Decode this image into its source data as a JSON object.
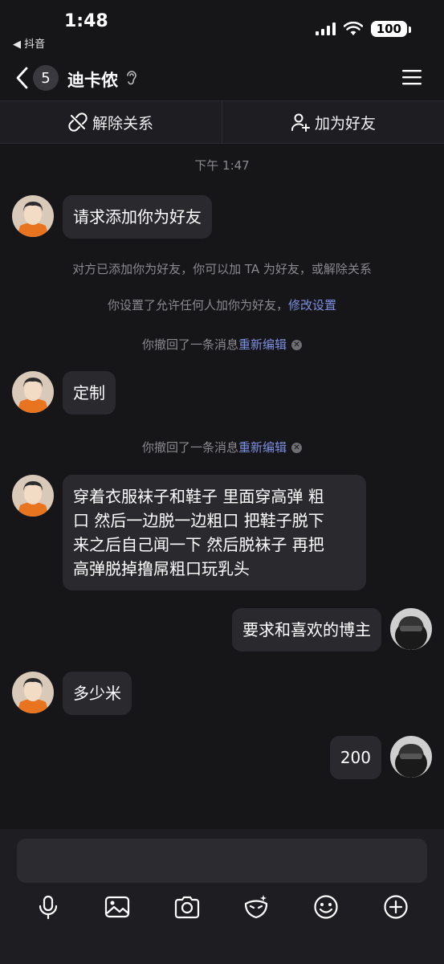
{
  "status_bar": {
    "time": "1:48",
    "back_app": "◀ 抖音",
    "battery": "100"
  },
  "header": {
    "unread_count": "5",
    "contact_name": "迪卡侬"
  },
  "actions": {
    "remove_relation": "解除关系",
    "add_friend": "加为好友"
  },
  "chat": {
    "timestamp": "下午 1:47",
    "msg1": "请求添加你为好友",
    "sys_added": "对方已添加你为好友，你可以加 TA 为好友，或解除关系",
    "sys_settings": "你设置了允许任何人加你为好友，",
    "sys_settings_link": "修改设置",
    "recall1_text": "你撤回了一条消息",
    "recall1_link": "重新编辑",
    "msg2": "定制",
    "recall2_text": "你撤回了一条消息",
    "recall2_link": "重新编辑",
    "msg3_line1": "穿着衣服袜子和鞋子 里面穿高弹 粗",
    "msg3_line2": "口 然后一边脱一边粗口 把鞋子脱下",
    "msg3_line3": "来之后自己闻一下 然后脱袜子 再把",
    "msg3_line4": "高弹脱掉撸屌粗口玩乳头",
    "msg4_self": "要求和喜欢的博主",
    "msg5": "多少米",
    "msg6_self": "200"
  },
  "colors": {
    "background": "#161619",
    "bubble": "#2a2a2e",
    "link": "#7d8fe0",
    "avatar_orange": "#e8741f"
  }
}
